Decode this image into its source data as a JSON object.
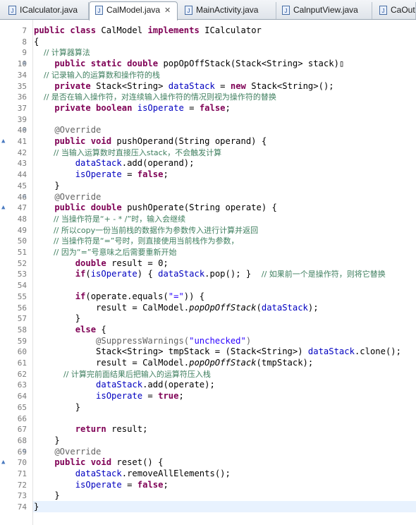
{
  "tabs": [
    {
      "label": "ICalculator.java",
      "active": false
    },
    {
      "label": "CalModel.java",
      "active": true,
      "close": "✕"
    },
    {
      "label": "MainActivity.java",
      "active": false
    },
    {
      "label": "CalnputView.java",
      "active": false
    },
    {
      "label": "CaOut",
      "active": false
    }
  ],
  "code_lines": [
    {
      "num": "7",
      "mark": "",
      "segments": [
        {
          "t": "kw",
          "v": "public class "
        },
        {
          "t": "",
          "v": "CalModel "
        },
        {
          "t": "kw",
          "v": "implements "
        },
        {
          "t": "",
          "v": "ICalculator"
        }
      ]
    },
    {
      "num": "8",
      "mark": "",
      "segments": [
        {
          "t": "",
          "v": "{"
        }
      ]
    },
    {
      "num": "9",
      "mark": "",
      "segments": [
        {
          "t": "cm",
          "v": "    // 计算器算法"
        }
      ]
    },
    {
      "num": "10",
      "mark": "⊕",
      "segments": [
        {
          "t": "kw",
          "v": "    public static double "
        },
        {
          "t": "",
          "v": "popOpOffStack(Stack<String> stack)"
        },
        {
          "t": "",
          "v": "▯"
        }
      ]
    },
    {
      "num": "34",
      "mark": "",
      "segments": [
        {
          "t": "cm",
          "v": "    // 记录输入的运算数和操作符的栈"
        }
      ]
    },
    {
      "num": "35",
      "mark": "",
      "segments": [
        {
          "t": "kw",
          "v": "    private "
        },
        {
          "t": "",
          "v": "Stack<String> "
        },
        {
          "t": "fld",
          "v": "dataStack"
        },
        {
          "t": "",
          "v": " = "
        },
        {
          "t": "kw",
          "v": "new "
        },
        {
          "t": "",
          "v": "Stack<String>();"
        }
      ]
    },
    {
      "num": "36",
      "mark": "",
      "segments": [
        {
          "t": "cm",
          "v": "    // 是否在输入操作符，对连续输入操作符的情况则视为操作符的替换"
        }
      ]
    },
    {
      "num": "37",
      "mark": "",
      "segments": [
        {
          "t": "kw",
          "v": "    private boolean "
        },
        {
          "t": "fld",
          "v": "isOperate"
        },
        {
          "t": "",
          "v": " = "
        },
        {
          "t": "kw",
          "v": "false"
        },
        {
          "t": "",
          "v": ";"
        }
      ]
    },
    {
      "num": "39",
      "mark": "",
      "segments": []
    },
    {
      "num": "40",
      "mark": "⊖",
      "segments": [
        {
          "t": "ann",
          "v": "    @Override"
        }
      ]
    },
    {
      "num": "41",
      "mark": "▲",
      "segments": [
        {
          "t": "kw",
          "v": "    public void "
        },
        {
          "t": "",
          "v": "pushOperand(String operand) {"
        }
      ]
    },
    {
      "num": "42",
      "mark": "",
      "segments": [
        {
          "t": "cm",
          "v": "        // 当输入运算数时直接压入stack，不会触发计算"
        }
      ]
    },
    {
      "num": "43",
      "mark": "",
      "segments": [
        {
          "t": "fld",
          "v": "        dataStack"
        },
        {
          "t": "",
          "v": ".add(operand);"
        }
      ]
    },
    {
      "num": "44",
      "mark": "",
      "segments": [
        {
          "t": "fld",
          "v": "        isOperate"
        },
        {
          "t": "",
          "v": " = "
        },
        {
          "t": "kw",
          "v": "false"
        },
        {
          "t": "",
          "v": ";"
        }
      ]
    },
    {
      "num": "45",
      "mark": "",
      "segments": [
        {
          "t": "",
          "v": "    }"
        }
      ]
    },
    {
      "num": "46",
      "mark": "⊖",
      "segments": [
        {
          "t": "ann",
          "v": "    @Override"
        }
      ]
    },
    {
      "num": "47",
      "mark": "▲",
      "segments": [
        {
          "t": "kw",
          "v": "    public double "
        },
        {
          "t": "",
          "v": "pushOperate(String operate) {"
        }
      ]
    },
    {
      "num": "48",
      "mark": "",
      "segments": [
        {
          "t": "cm",
          "v": "        // 当操作符是“+ - * /”时，输入会继续"
        }
      ]
    },
    {
      "num": "49",
      "mark": "",
      "segments": [
        {
          "t": "cm",
          "v": "        // 所以copy一份当前栈的数据作为参数传入进行计算并返回"
        }
      ]
    },
    {
      "num": "50",
      "mark": "",
      "segments": [
        {
          "t": "cm",
          "v": "        // 当操作符是“=”号时，则直接使用当前栈作为参数，"
        }
      ]
    },
    {
      "num": "51",
      "mark": "",
      "segments": [
        {
          "t": "cm",
          "v": "        // 因为“=”号意味之后需要重新开始"
        }
      ]
    },
    {
      "num": "52",
      "mark": "",
      "segments": [
        {
          "t": "kw",
          "v": "        double "
        },
        {
          "t": "",
          "v": "result = 0;"
        }
      ]
    },
    {
      "num": "53",
      "mark": "",
      "segments": [
        {
          "t": "kw",
          "v": "        if"
        },
        {
          "t": "",
          "v": "("
        },
        {
          "t": "fld",
          "v": "isOperate"
        },
        {
          "t": "",
          "v": ") { "
        },
        {
          "t": "fld",
          "v": "dataStack"
        },
        {
          "t": "",
          "v": ".pop(); }  "
        },
        {
          "t": "cm",
          "v": "// 如果前一个是操作符，则将它替换"
        }
      ]
    },
    {
      "num": "54",
      "mark": "",
      "segments": []
    },
    {
      "num": "55",
      "mark": "",
      "segments": [
        {
          "t": "kw",
          "v": "        if"
        },
        {
          "t": "",
          "v": "(operate.equals("
        },
        {
          "t": "str",
          "v": "\"=\""
        },
        {
          "t": "",
          "v": ")) {"
        }
      ]
    },
    {
      "num": "56",
      "mark": "",
      "segments": [
        {
          "t": "",
          "v": "            result = CalModel."
        },
        {
          "t": "sm",
          "v": "popOpOffStack"
        },
        {
          "t": "",
          "v": "("
        },
        {
          "t": "fld",
          "v": "dataStack"
        },
        {
          "t": "",
          "v": ");"
        }
      ]
    },
    {
      "num": "57",
      "mark": "",
      "segments": [
        {
          "t": "",
          "v": "        }"
        }
      ]
    },
    {
      "num": "58",
      "mark": "",
      "segments": [
        {
          "t": "kw",
          "v": "        else "
        },
        {
          "t": "",
          "v": "{"
        }
      ]
    },
    {
      "num": "59",
      "mark": "",
      "segments": [
        {
          "t": "ann",
          "v": "            @SuppressWarnings("
        },
        {
          "t": "str",
          "v": "\"unchecked\""
        },
        {
          "t": "ann",
          "v": ")"
        }
      ]
    },
    {
      "num": "60",
      "mark": "",
      "segments": [
        {
          "t": "",
          "v": "            Stack<String> tmpStack = (Stack<String>) "
        },
        {
          "t": "fld",
          "v": "dataStack"
        },
        {
          "t": "",
          "v": ".clone();"
        }
      ]
    },
    {
      "num": "61",
      "mark": "",
      "segments": [
        {
          "t": "",
          "v": "            result = CalModel."
        },
        {
          "t": "sm",
          "v": "popOpOffStack"
        },
        {
          "t": "",
          "v": "(tmpStack);"
        }
      ]
    },
    {
      "num": "62",
      "mark": "",
      "segments": [
        {
          "t": "cm",
          "v": "            // 计算完前面结果后把输入的运算符压入栈"
        }
      ]
    },
    {
      "num": "63",
      "mark": "",
      "segments": [
        {
          "t": "fld",
          "v": "            dataStack"
        },
        {
          "t": "",
          "v": ".add(operate);"
        }
      ]
    },
    {
      "num": "64",
      "mark": "",
      "segments": [
        {
          "t": "fld",
          "v": "            isOperate"
        },
        {
          "t": "",
          "v": " = "
        },
        {
          "t": "kw",
          "v": "true"
        },
        {
          "t": "",
          "v": ";"
        }
      ]
    },
    {
      "num": "65",
      "mark": "",
      "segments": [
        {
          "t": "",
          "v": "        }"
        }
      ]
    },
    {
      "num": "66",
      "mark": "",
      "segments": []
    },
    {
      "num": "67",
      "mark": "",
      "segments": [
        {
          "t": "kw",
          "v": "        return "
        },
        {
          "t": "",
          "v": "result;"
        }
      ]
    },
    {
      "num": "68",
      "mark": "",
      "segments": [
        {
          "t": "",
          "v": "    }"
        }
      ]
    },
    {
      "num": "69",
      "mark": "⊖",
      "segments": [
        {
          "t": "ann",
          "v": "    @Override"
        }
      ]
    },
    {
      "num": "70",
      "mark": "▲",
      "segments": [
        {
          "t": "kw",
          "v": "    public void "
        },
        {
          "t": "",
          "v": "reset() {"
        }
      ]
    },
    {
      "num": "71",
      "mark": "",
      "segments": [
        {
          "t": "fld",
          "v": "        dataStack"
        },
        {
          "t": "",
          "v": ".removeAllElements();"
        }
      ]
    },
    {
      "num": "72",
      "mark": "",
      "segments": [
        {
          "t": "fld",
          "v": "        isOperate"
        },
        {
          "t": "",
          "v": " = "
        },
        {
          "t": "kw",
          "v": "false"
        },
        {
          "t": "",
          "v": ";"
        }
      ]
    },
    {
      "num": "73",
      "mark": "",
      "segments": [
        {
          "t": "",
          "v": "    }"
        }
      ]
    },
    {
      "num": "74",
      "mark": "",
      "segments": [
        {
          "t": "",
          "v": "}"
        }
      ]
    }
  ],
  "colors": {
    "keyword": "#7f0055",
    "field": "#0000c0",
    "comment": "#3f7f5f",
    "string": "#2a00ff",
    "annotation": "#646464",
    "current_line": "#e8f2fe"
  }
}
